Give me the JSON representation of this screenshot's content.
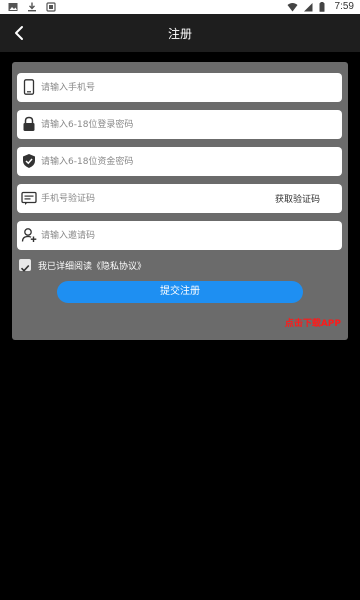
{
  "status_bar": {
    "time": "7:59",
    "left_icons": [
      "image-icon",
      "download-icon",
      "app-icon"
    ],
    "right_icons": [
      "wifi-icon",
      "signal-icon",
      "battery-icon"
    ]
  },
  "header": {
    "title": "注册",
    "back_icon": "chevron-left-icon"
  },
  "form": {
    "phone_placeholder": "请输入手机号",
    "login_password_placeholder": "请输入6-18位登录密码",
    "fund_password_placeholder": "请输入6-18位资金密码",
    "sms_code_placeholder": "手机号验证码",
    "get_code_label": "获取验证码",
    "invite_code_placeholder": "请输入邀请码",
    "agree_text": "我已详细阅读《隐私协议》",
    "agree_checked": true,
    "submit_label": "提交注册",
    "download_label": "点击下载APP"
  },
  "colors": {
    "background": "#000000",
    "panel": "#6b6b6b",
    "accent": "#1e8ff2",
    "download_link": "#ff1a1a"
  }
}
